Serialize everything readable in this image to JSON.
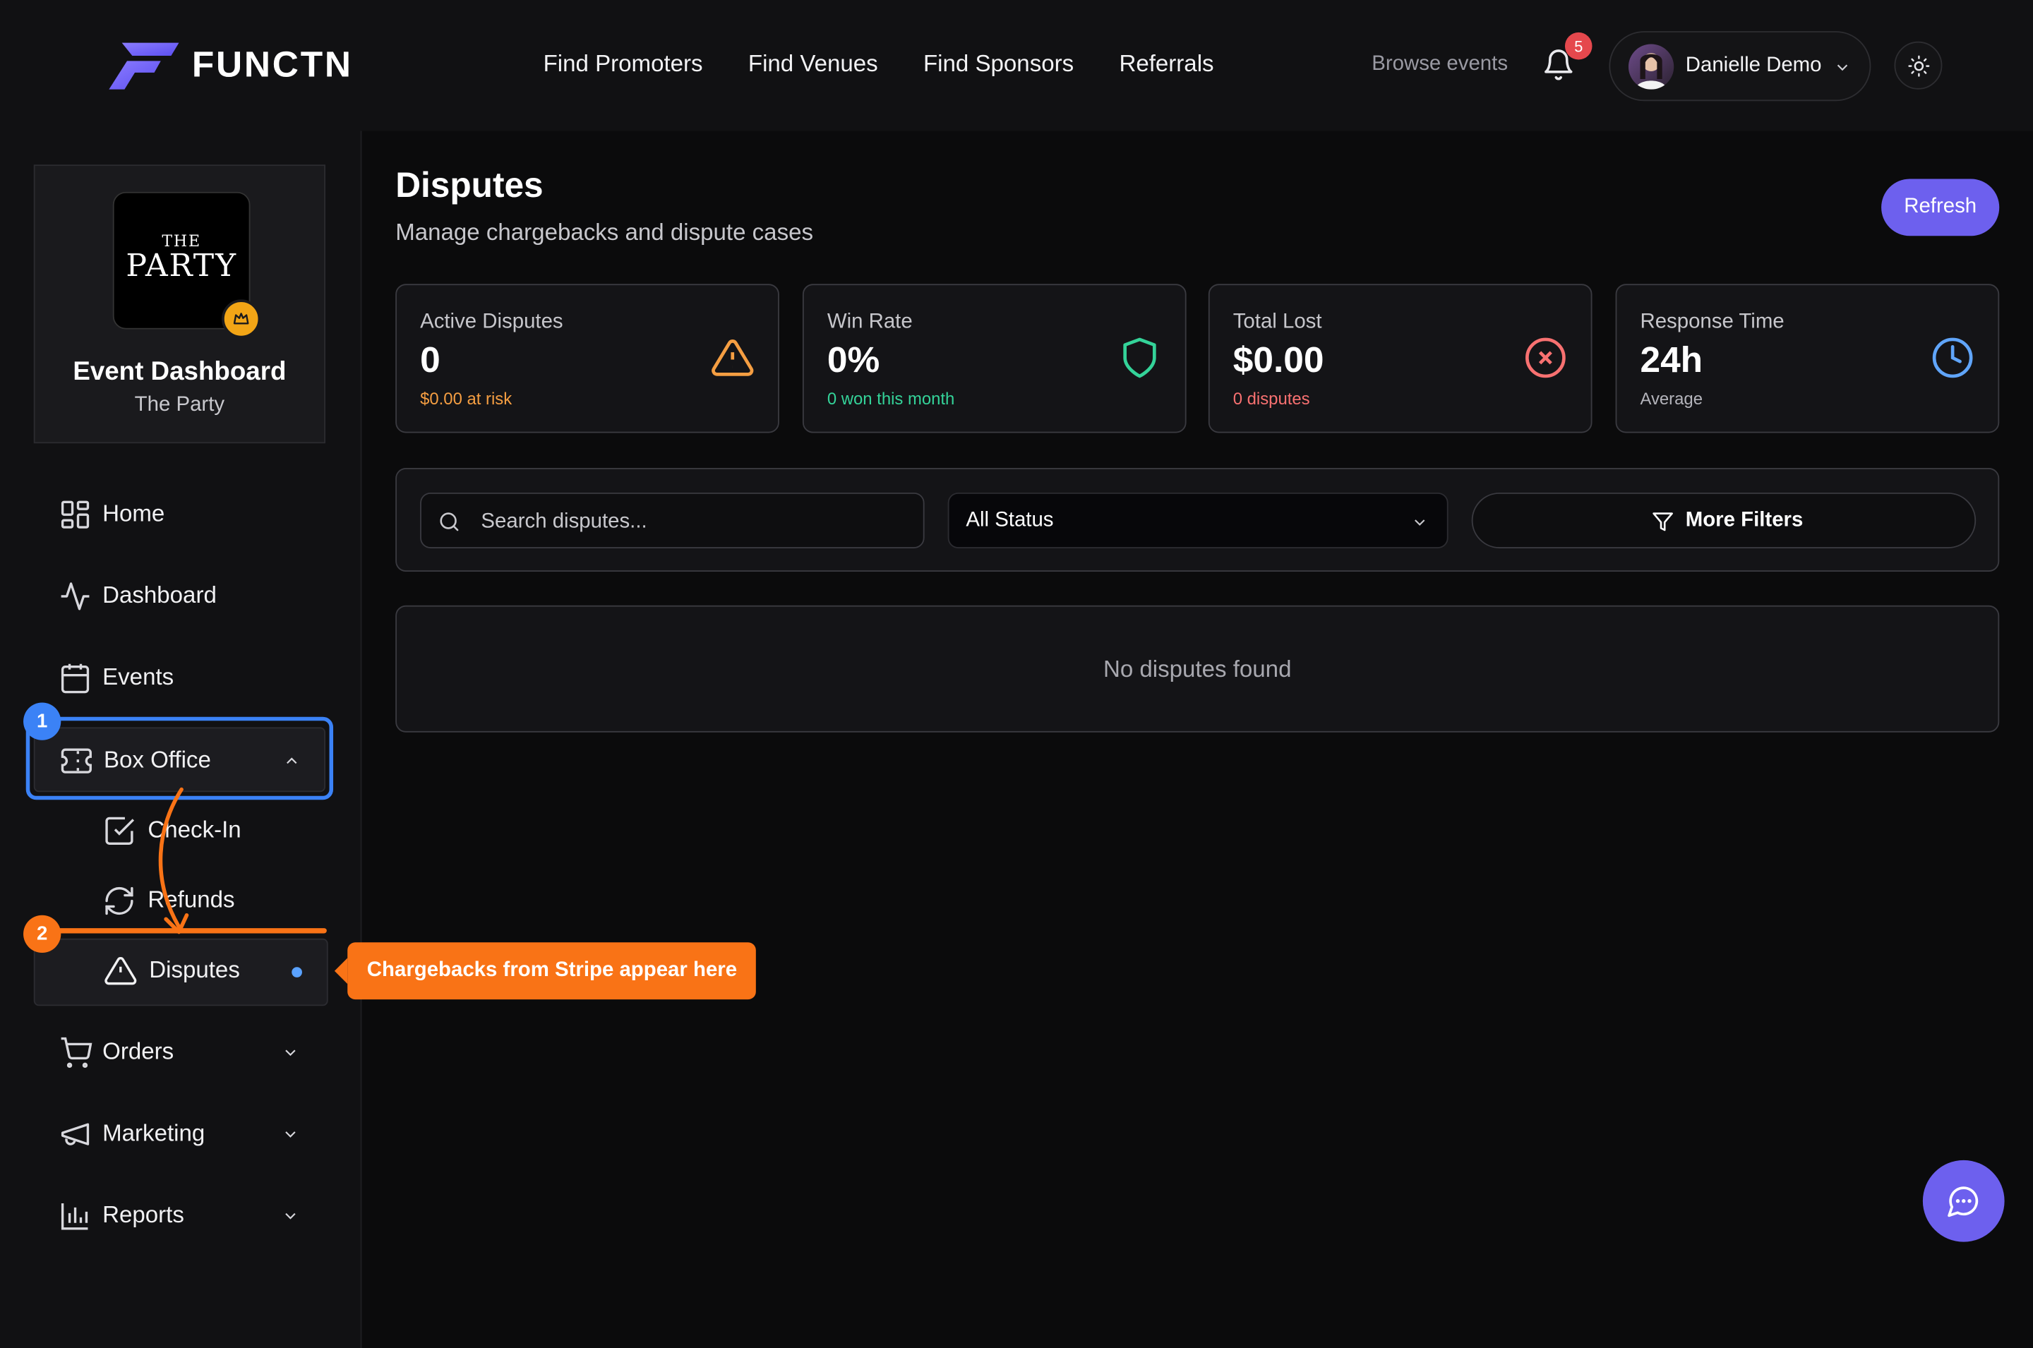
{
  "app": {
    "brand": "FUNCTN"
  },
  "topnav": {
    "links": [
      "Find Promoters",
      "Find Venues",
      "Find Sponsors",
      "Referrals"
    ],
    "browse": "Browse events",
    "notification_count": "5",
    "user_name": "Danielle Demo"
  },
  "event": {
    "logo_line1": "THE",
    "logo_line2": "PARTY",
    "title": "Event Dashboard",
    "subtitle": "The Party"
  },
  "sidebar": {
    "items": [
      {
        "label": "Home",
        "icon": "grid-icon"
      },
      {
        "label": "Dashboard",
        "icon": "activity-icon"
      },
      {
        "label": "Events",
        "icon": "calendar-icon"
      },
      {
        "label": "Box Office",
        "icon": "ticket-icon",
        "expanded": true
      },
      {
        "label": "Orders",
        "icon": "cart-icon"
      },
      {
        "label": "Marketing",
        "icon": "megaphone-icon"
      },
      {
        "label": "Reports",
        "icon": "bar-chart-icon"
      }
    ],
    "box_office_sub": [
      {
        "label": "Check-In",
        "icon": "check-square-icon"
      },
      {
        "label": "Refunds",
        "icon": "refresh-icon"
      },
      {
        "label": "Disputes",
        "icon": "alert-triangle-icon",
        "active": true
      }
    ]
  },
  "annotations": {
    "step1": "1",
    "step2": "2",
    "callout": "Chargebacks from Stripe appear here",
    "colors": {
      "step1": "#3b82f6",
      "step2": "#f97316"
    }
  },
  "page": {
    "title": "Disputes",
    "subtitle": "Manage chargebacks and dispute cases",
    "refresh_label": "Refresh"
  },
  "stats": [
    {
      "title": "Active Disputes",
      "value": "0",
      "sub": "$0.00 at risk",
      "sub_color": "#f59e42",
      "icon": "alert-triangle-icon",
      "icon_color": "#f59e42"
    },
    {
      "title": "Win Rate",
      "value": "0%",
      "sub": "0 won this month",
      "sub_color": "#34d399",
      "icon": "shield-icon",
      "icon_color": "#34d399"
    },
    {
      "title": "Total Lost",
      "value": "$0.00",
      "sub": "0 disputes",
      "sub_color": "#f87171",
      "icon": "x-circle-icon",
      "icon_color": "#f87171"
    },
    {
      "title": "Response Time",
      "value": "24h",
      "sub": "Average",
      "sub_color": "#b4b4bb",
      "icon": "clock-icon",
      "icon_color": "#60a5fa"
    }
  ],
  "filters": {
    "search_placeholder": "Search disputes...",
    "status_selected": "All Status",
    "more_filters_label": "More Filters"
  },
  "empty_state": "No disputes found",
  "colors": {
    "accent": "#6d60ee",
    "background": "#0b0b0c",
    "panel": "#141417"
  }
}
